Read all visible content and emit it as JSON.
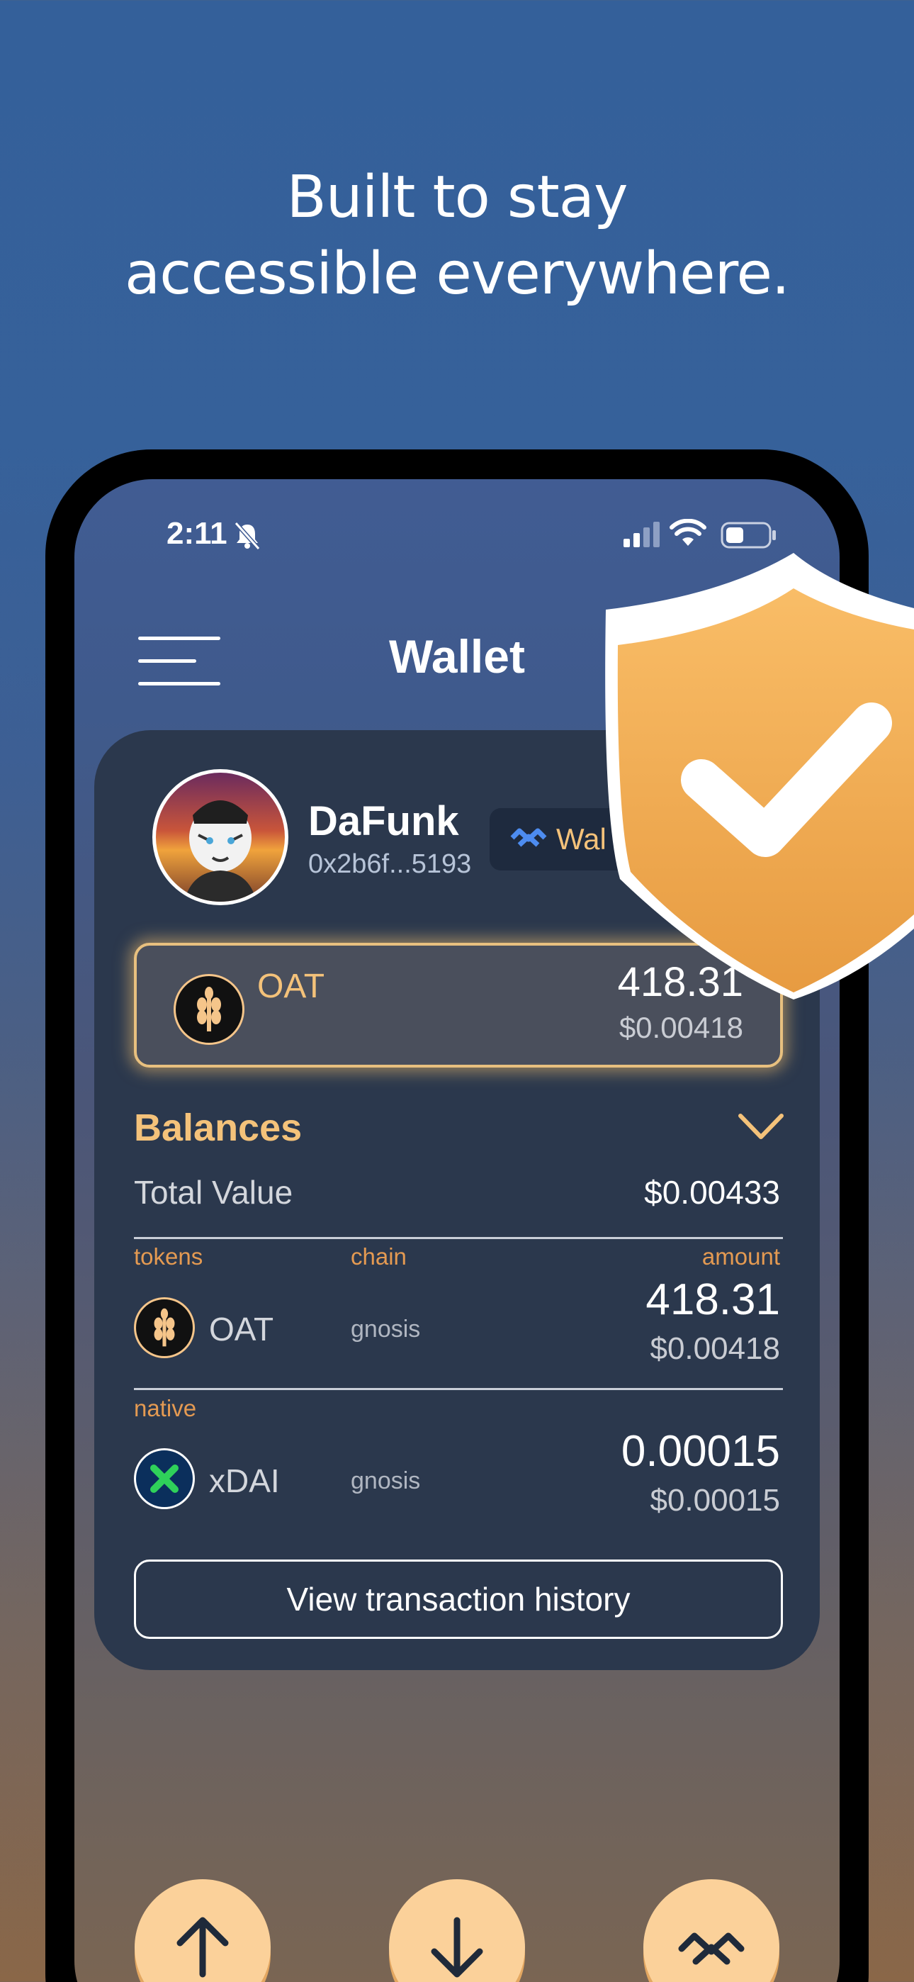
{
  "promo": {
    "headline_line1": "Built to stay",
    "headline_line2": "accessible everywhere."
  },
  "status_bar": {
    "time": "2:11"
  },
  "header": {
    "title": "Wallet"
  },
  "profile": {
    "name": "DaFunk",
    "address": "0x2b6f...5193",
    "connect_chip_label": "Wal"
  },
  "featured_token": {
    "symbol": "OAT",
    "amount": "418.31",
    "usd": "$0.00418"
  },
  "balances": {
    "title": "Balances",
    "total_label": "Total Value",
    "total_value": "$0.00433",
    "col_tokens": "tokens",
    "col_chain": "chain",
    "col_amount": "amount",
    "native_label": "native",
    "tokens": [
      {
        "symbol": "OAT",
        "chain": "gnosis",
        "amount": "418.31",
        "usd": "$0.00418"
      }
    ],
    "native": [
      {
        "symbol": "xDAI",
        "chain": "gnosis",
        "amount": "0.00015",
        "usd": "$0.00015"
      }
    ]
  },
  "history_button_label": "View transaction history",
  "colors": {
    "accent": "#f4c27a",
    "card": "#2b384d",
    "action_button": "#fbd19a",
    "shield": "#f5b35c"
  },
  "icons": {
    "menu": "hamburger-icon",
    "chevron": "chevron-down-icon",
    "send": "arrow-up-icon",
    "receive": "arrow-down-icon",
    "walletconnect": "walletconnect-icon",
    "badge": "shield-check-icon"
  }
}
